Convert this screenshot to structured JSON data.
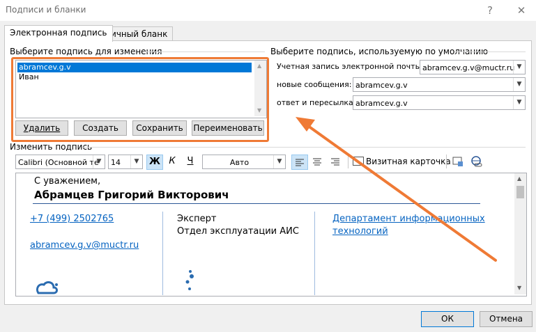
{
  "window": {
    "title": "Подписи и бланки",
    "help": "?",
    "close": "✕"
  },
  "tabs": [
    {
      "label": "Электронная подпись"
    },
    {
      "label": "Личный бланк"
    }
  ],
  "select_section": {
    "label": "Выберите подпись для изменения",
    "items": [
      "abramcev.g.v",
      "Иван"
    ],
    "buttons": {
      "delete": "Удалить",
      "create": "Создать",
      "save": "Сохранить",
      "rename": "Переименовать"
    }
  },
  "default_section": {
    "label": "Выберите подпись, используемую по умолчанию",
    "account_label": "Учетная запись электронной почты:",
    "account_value": "abramcev.g.v@muctr.ru",
    "new_label": "новые сообщения:",
    "new_value": "abramcev.g.v",
    "reply_label": "ответ и пересылка:",
    "reply_value": "abramcev.g.v"
  },
  "edit_section": {
    "label": "Изменить подпись",
    "font": "Calibri (Основной те",
    "size": "14",
    "bold": "Ж",
    "italic": "К",
    "underline": "Ч",
    "color": "Авто",
    "business_card": "Визитная карточка"
  },
  "signature": {
    "greeting": "С уважением,",
    "name": "Абрамцев Григорий Викторович",
    "phone": "+7 (499) 2502765",
    "email": "abramcev.g.v@muctr.ru",
    "position": "Эксперт",
    "department": "Отдел эксплуатации АИС",
    "division_line1": "Департамент информационных",
    "division_line2": "технологий"
  },
  "footer": {
    "ok": "ОК",
    "cancel": "Отмена"
  },
  "colors": {
    "highlight": "#ef7a35",
    "selection": "#0078d7",
    "link": "#0563c1"
  }
}
